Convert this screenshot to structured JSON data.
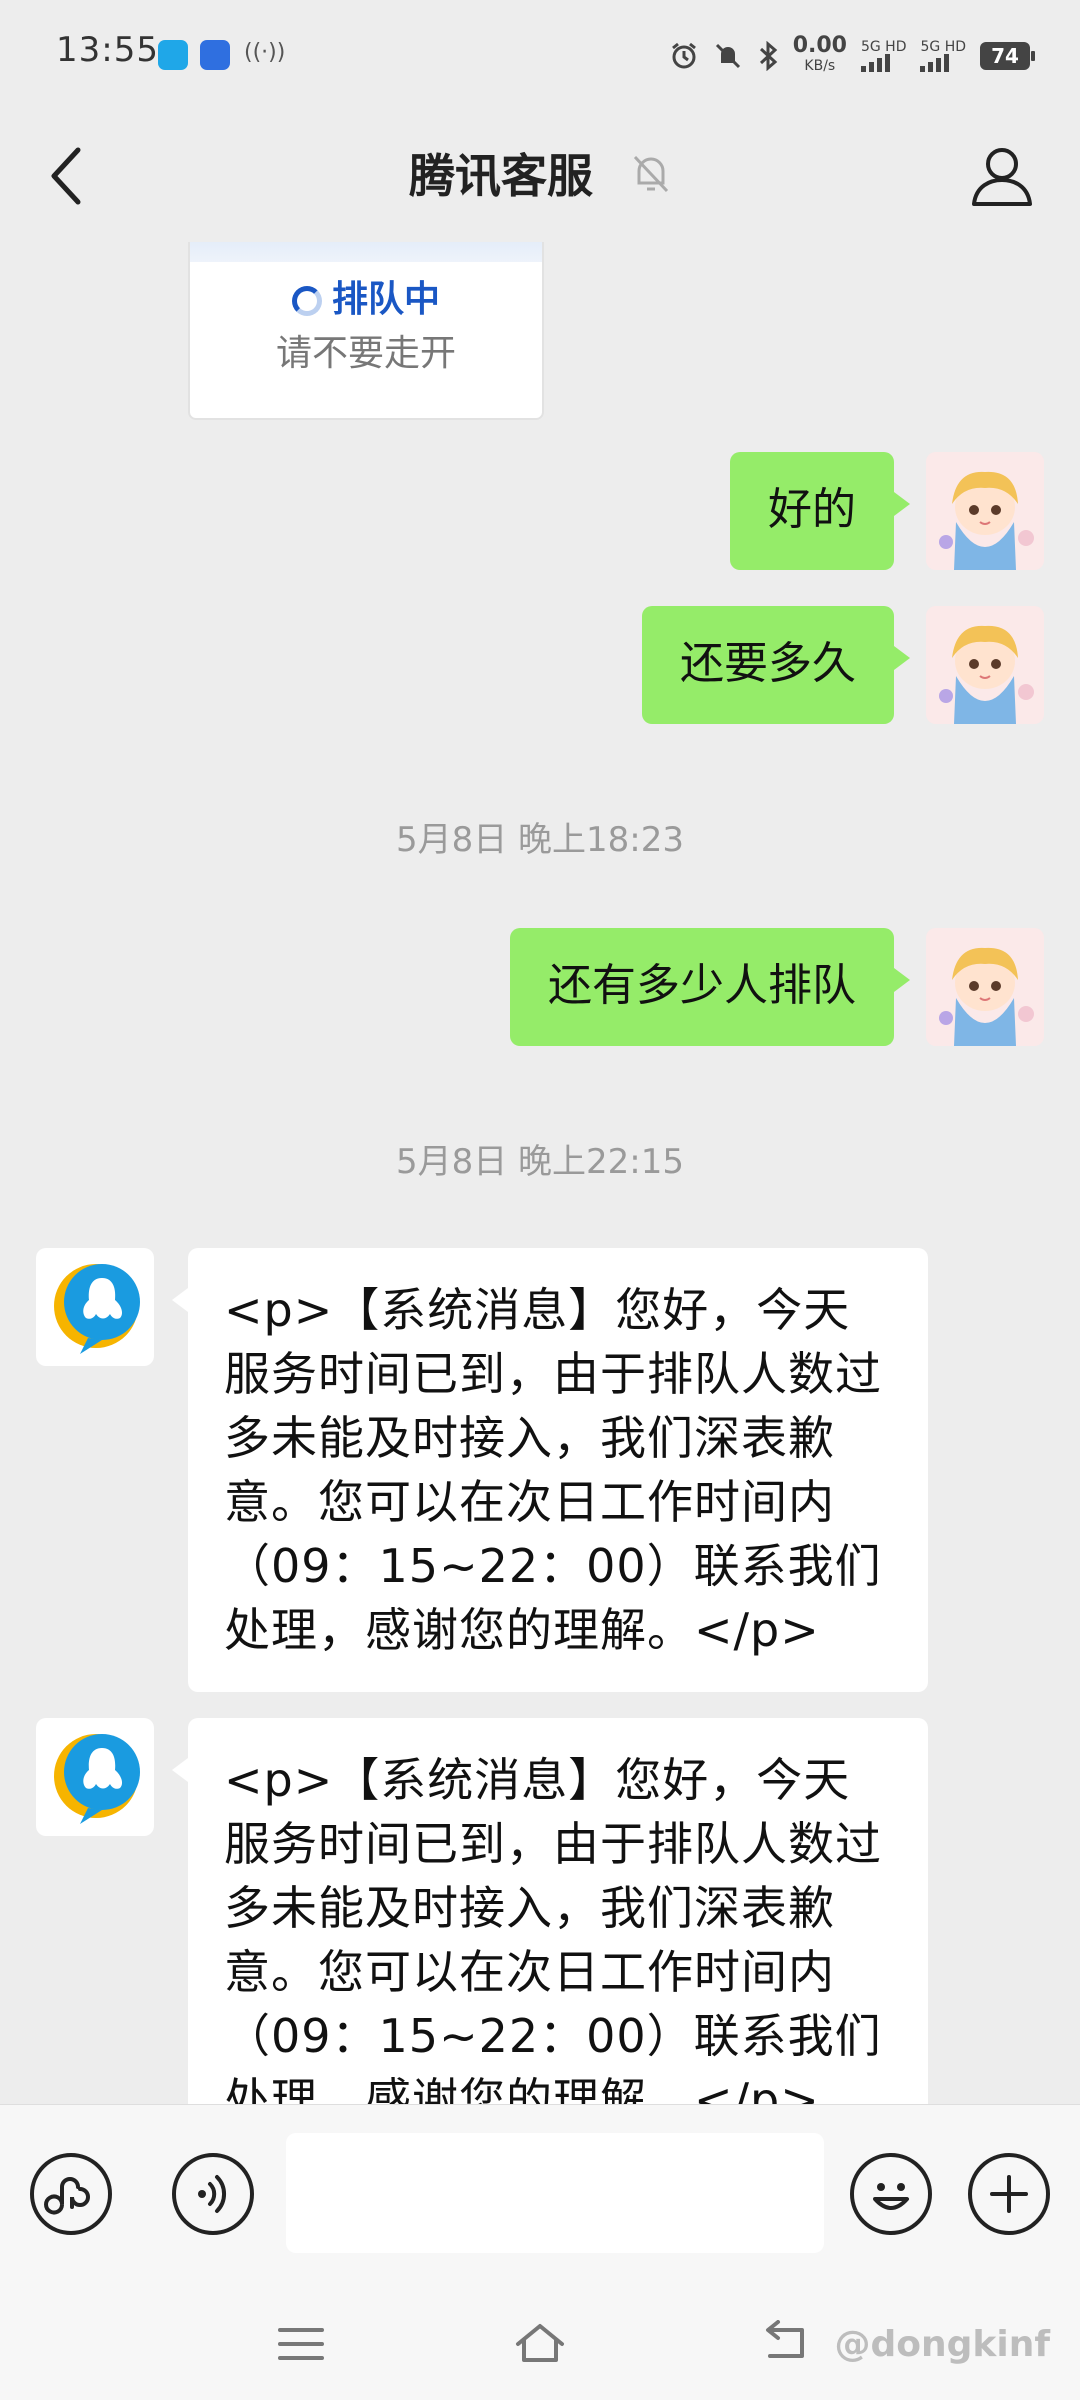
{
  "status_bar": {
    "time": "13:55",
    "net_speed_value": "0.00",
    "net_speed_unit": "KB/s",
    "sim1": "5G HD",
    "sim2": "5G HD",
    "battery": "74",
    "icons": [
      "alarm-icon",
      "mute-icon",
      "bluetooth-icon",
      "signal-icon",
      "battery-icon"
    ]
  },
  "header": {
    "title": "腾讯客服",
    "icons": [
      "back-icon",
      "bell-muted-icon",
      "profile-icon"
    ]
  },
  "queue_card": {
    "status": "排队中",
    "subtitle": "请不要走开"
  },
  "messages": [
    {
      "type": "sent",
      "text": "好的"
    },
    {
      "type": "sent",
      "text": "还要多久"
    },
    {
      "type": "timestamp",
      "text": "5月8日 晚上18:23"
    },
    {
      "type": "sent",
      "text": "还有多少人排队"
    },
    {
      "type": "timestamp",
      "text": "5月8日 晚上22:15"
    },
    {
      "type": "received",
      "text": "<p>【系统消息】您好，今天服务时间已到，由于排队人数过多未能及时接入，我们深表歉意。您可以在次日工作时间内（09：15~22：00）联系我们处理，感谢您的理解。</p>"
    },
    {
      "type": "received",
      "text": "<p>【系统消息】您好，今天服务时间已到，由于排队人数过多未能及时接入，我们深表歉意。您可以在次日工作时间内（09：15~22：00）联系我们处理，感谢您的理解。</p>"
    }
  ],
  "input_bar": {
    "placeholder": "",
    "icons": [
      "mini-program-icon",
      "voice-icon",
      "emoji-icon",
      "plus-icon"
    ]
  },
  "nav_bar": {
    "icons": [
      "menu-icon",
      "home-icon",
      "back-nav-icon"
    ],
    "watermark": "@dongkinf"
  },
  "colors": {
    "sent_bubble": "#95ec69",
    "background": "#ededed",
    "queue_blue": "#1a57c4"
  }
}
